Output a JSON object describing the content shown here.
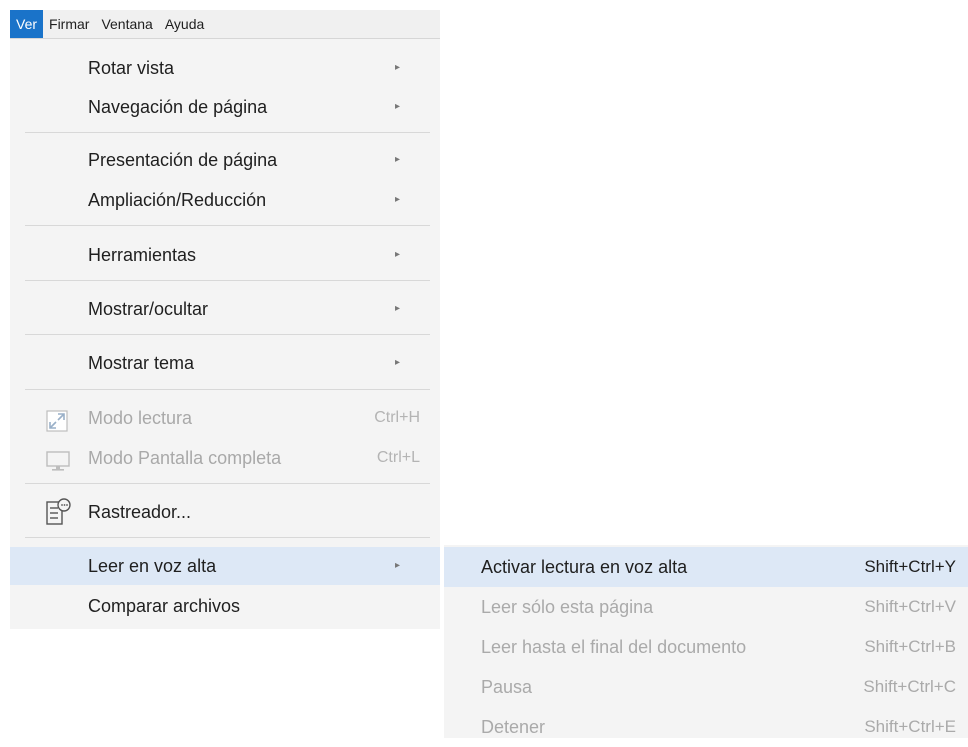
{
  "menubar": {
    "items": [
      {
        "label": "Ver"
      },
      {
        "label": "Firmar"
      },
      {
        "label": "Ventana"
      },
      {
        "label": "Ayuda"
      }
    ]
  },
  "menu": {
    "rotar_vista": "Rotar vista",
    "navegacion_pagina": "Navegación de página",
    "presentacion_pagina": "Presentación de página",
    "ampliacion_reduccion": "Ampliación/Reducción",
    "herramientas": "Herramientas",
    "mostrar_ocultar": "Mostrar/ocultar",
    "mostrar_tema": "Mostrar tema",
    "modo_lectura": "Modo lectura",
    "modo_lectura_shortcut": "Ctrl+H",
    "modo_pantalla": "Modo Pantalla completa",
    "modo_pantalla_shortcut": "Ctrl+L",
    "rastreador": "Rastreador...",
    "leer_voz_alta": "Leer en voz alta",
    "comparar_archivos": "Comparar archivos",
    "submenu_arrow": "▸"
  },
  "submenu": {
    "activar": "Activar lectura en voz alta",
    "activar_shortcut": "Shift+Ctrl+Y",
    "leer_pagina": "Leer sólo esta página",
    "leer_pagina_shortcut": "Shift+Ctrl+V",
    "leer_final": "Leer hasta el final del documento",
    "leer_final_shortcut": "Shift+Ctrl+B",
    "pausa": "Pausa",
    "pausa_shortcut": "Shift+Ctrl+C",
    "detener": "Detener",
    "detener_shortcut": "Shift+Ctrl+E"
  },
  "colors": {
    "accent": "#1a73c9",
    "highlight": "#dde8f6",
    "menu_bg": "#f4f4f4",
    "disabled_text": "#a9a9a9"
  },
  "icons": {
    "modo_lectura": "expand-icon",
    "modo_pantalla": "monitor-icon",
    "rastreador": "tracker-document-icon",
    "submenu": "chevron-right-icon"
  }
}
